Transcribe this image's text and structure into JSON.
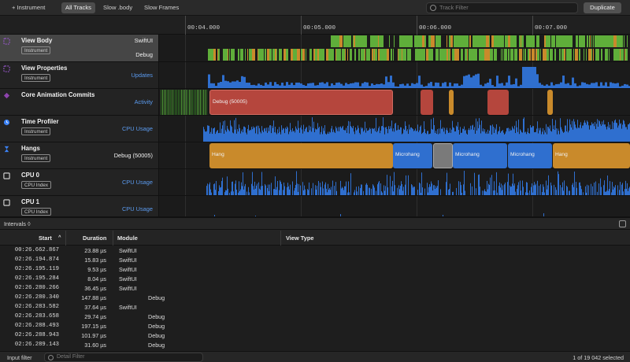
{
  "toolbar": {
    "instrument_label": "+ Instrument",
    "filters": [
      "All Tracks",
      "Slow .body",
      "Slow Frames"
    ],
    "active_filter": "All Tracks",
    "track_filter_placeholder": "Track Filter",
    "duplicate_label": "Duplicate"
  },
  "ruler": {
    "ticks": [
      "00:04.000",
      "00:05.000",
      "00:06.000",
      "00:07.000"
    ]
  },
  "tracks": [
    {
      "name": "View Body",
      "badge": "Instrument",
      "sublanes": [
        "SwiftUI",
        "Debug"
      ],
      "icon": "view-body-icon",
      "color": "#9b59d0"
    },
    {
      "name": "View Properties",
      "badge": "Instrument",
      "sublanes": [
        "Updates"
      ],
      "icon": "view-properties-icon",
      "color": "#9b59d0"
    },
    {
      "name": "Core Animation Commits",
      "badge": "",
      "sublanes": [
        "Activity"
      ],
      "icon": "core-animation-icon",
      "color": "#8e44ad",
      "segment_label": "Debug (50005)"
    },
    {
      "name": "Time Profiler",
      "badge": "Instrument",
      "sublanes": [
        "CPU Usage"
      ],
      "icon": "time-profiler-icon",
      "color": "#3b82f6"
    },
    {
      "name": "Hangs",
      "badge": "Instrument",
      "sublanes": [
        "Debug (50005)"
      ],
      "icon": "hangs-icon",
      "color": "#3b82f6",
      "segments": [
        "Hang",
        "Microhang",
        "",
        "Microhang",
        "Microhang",
        "Hang"
      ]
    },
    {
      "name": "CPU 0",
      "badge": "CPU Index",
      "sublanes": [
        "CPU Usage"
      ],
      "icon": "cpu-icon",
      "color": "#cccccc"
    },
    {
      "name": "CPU 1",
      "badge": "CPU Index",
      "sublanes": [
        "CPU Usage"
      ],
      "icon": "cpu-icon",
      "color": "#cccccc"
    }
  ],
  "intervals": {
    "label": "Intervals ◊"
  },
  "table": {
    "headers": {
      "start": "Start",
      "sort_indicator": "^",
      "duration": "Duration",
      "module": "Module",
      "view_type": "View Type"
    },
    "rows": [
      {
        "start": "00:26.662.867",
        "duration": "23.88 µs",
        "module": "SwiftUI",
        "view_type": ""
      },
      {
        "start": "02:26.194.874",
        "duration": "15.83 µs",
        "module": "SwiftUI",
        "view_type": ""
      },
      {
        "start": "02:26.195.119",
        "duration": "9.53 µs",
        "module": "SwiftUI",
        "view_type": ""
      },
      {
        "start": "02:26.195.284",
        "duration": "8.04 µs",
        "module": "SwiftUI",
        "view_type": ""
      },
      {
        "start": "02:26.280.266",
        "duration": "36.45 µs",
        "module": "SwiftUI",
        "view_type": ""
      },
      {
        "start": "02:26.280.340",
        "duration": "147.88 µs",
        "module": "",
        "view_type": "Debug"
      },
      {
        "start": "02:26.283.582",
        "duration": "37.64 µs",
        "module": "SwiftUI",
        "view_type": ""
      },
      {
        "start": "02:26.283.658",
        "duration": "29.74 µs",
        "module": "",
        "view_type": "Debug"
      },
      {
        "start": "02:26.288.493",
        "duration": "197.15 µs",
        "module": "",
        "view_type": "Debug"
      },
      {
        "start": "02:26.288.943",
        "duration": "101.97 µs",
        "module": "",
        "view_type": "Debug"
      },
      {
        "start": "02:26.289.143",
        "duration": "31.60 µs",
        "module": "",
        "view_type": "Debug"
      }
    ]
  },
  "bottombar": {
    "label": "Input filter",
    "detail_placeholder": "Detail Filter",
    "selection_count": "1 of 19 042 selected"
  },
  "colors": {
    "green": "#5fae3a",
    "orange": "#c98a2b",
    "blue": "#2f6fcf",
    "red": "#c0463c",
    "gray": "#777777"
  }
}
